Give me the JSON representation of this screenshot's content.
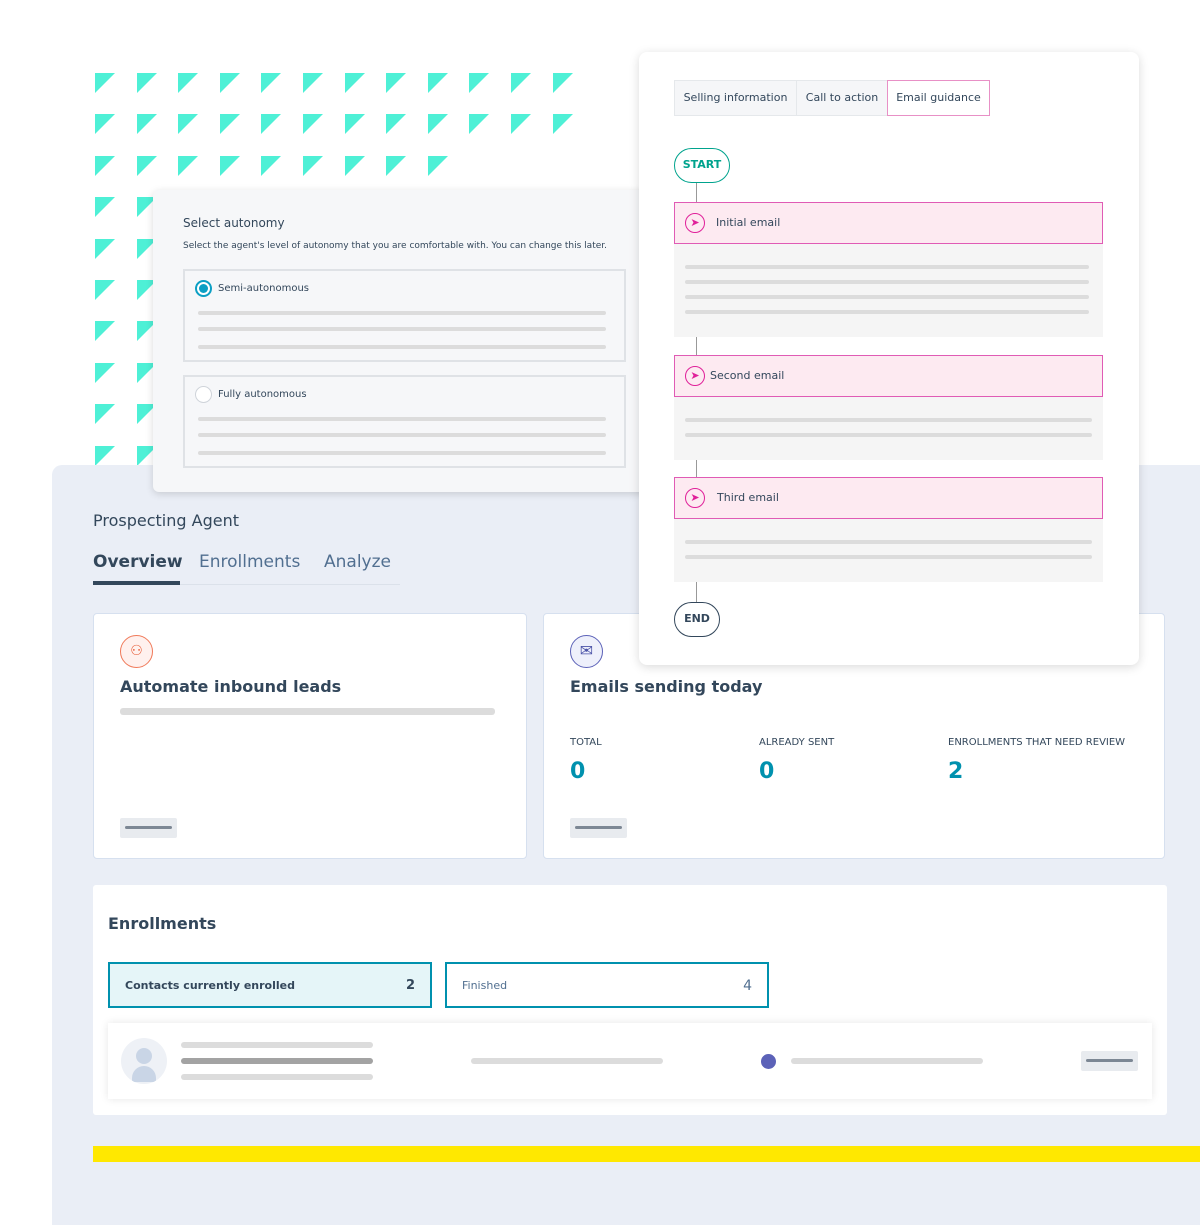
{
  "colors": {
    "accent": "#0091ae",
    "pattern": "#4ef0d6",
    "flow_pink": "#e0219a",
    "start_teal": "#00a38d",
    "highlight_yellow": "#ffe800",
    "status_dot": "#5c62b8"
  },
  "autonomy": {
    "title": "Select autonomy",
    "subtitle": "Select the agent's level of autonomy that you are comfortable with. You can change this later.",
    "options": [
      {
        "label": "Semi-autonomous",
        "selected": true
      },
      {
        "label": "Fully autonomous",
        "selected": false
      }
    ]
  },
  "flow": {
    "tabs": [
      "Selling information",
      "Call to action",
      "Email guidance"
    ],
    "active_tab": "Email guidance",
    "start": "START",
    "end": "END",
    "steps": [
      {
        "label": "Initial email",
        "icon": "send-icon"
      },
      {
        "label": "Second email",
        "icon": "send-icon"
      },
      {
        "label": "Third email",
        "icon": "send-icon"
      }
    ]
  },
  "agent": {
    "title": "Prospecting Agent",
    "tabs": [
      "Overview",
      "Enrollments",
      "Analyze"
    ],
    "active_tab": "Overview"
  },
  "cards": {
    "inbound": {
      "icon": "org-chart-icon",
      "title": "Automate inbound leads"
    },
    "emails": {
      "icon": "envelope-icon",
      "title": "Emails sending today",
      "stats": [
        {
          "label": "TOTAL",
          "value": "0"
        },
        {
          "label": "ALREADY SENT",
          "value": "0"
        },
        {
          "label": "ENROLLMENTS THAT NEED REVIEW",
          "value": "2"
        }
      ]
    }
  },
  "enrollments": {
    "title": "Enrollments",
    "filters": [
      {
        "label": "Contacts currently enrolled",
        "count": "2",
        "active": true
      },
      {
        "label": "Finished",
        "count": "4",
        "active": false
      }
    ]
  }
}
